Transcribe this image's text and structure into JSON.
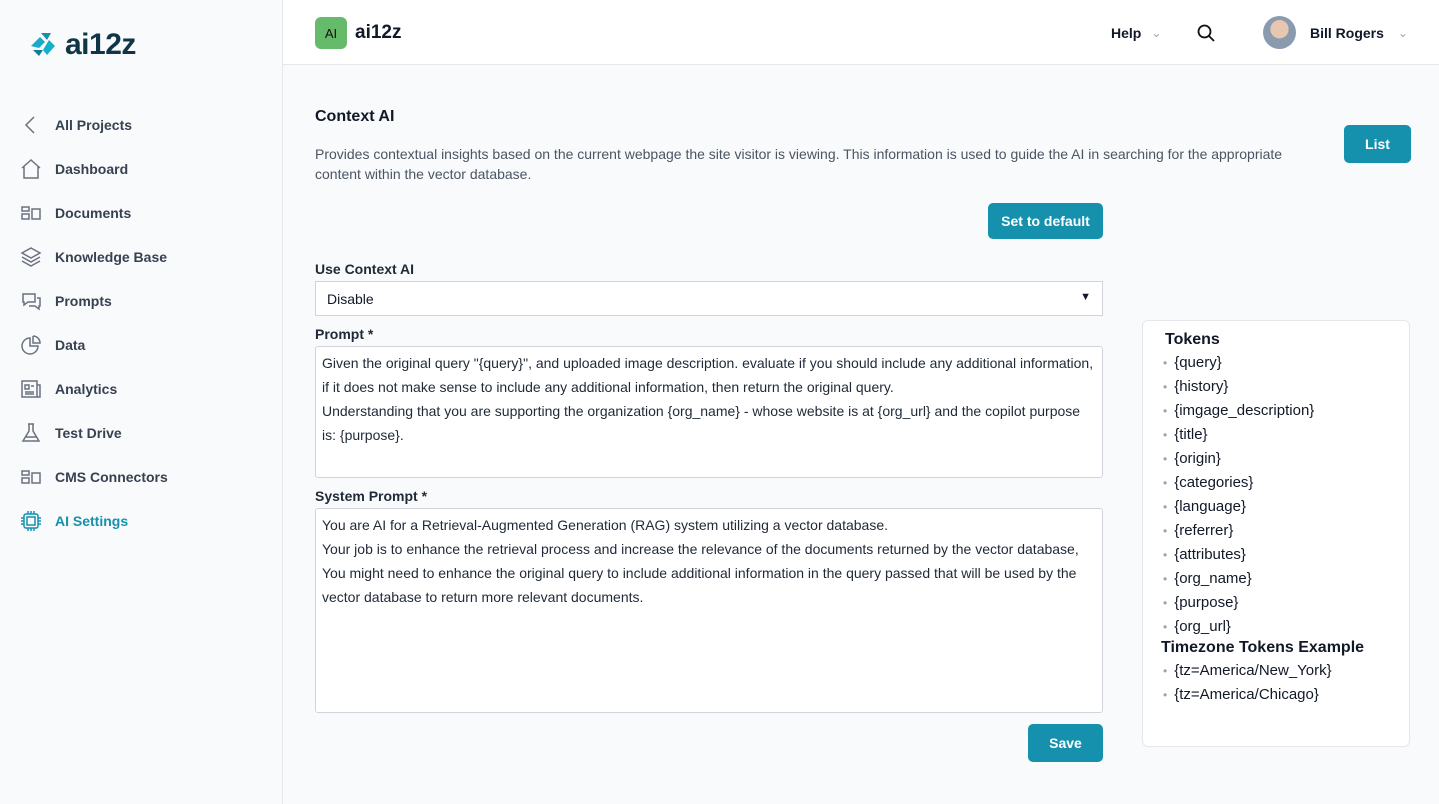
{
  "brand": {
    "logo_text": "ai12z"
  },
  "sidebar": {
    "items": [
      {
        "label": "All Projects",
        "icon": "chevron-left-icon"
      },
      {
        "label": "Dashboard",
        "icon": "home-icon"
      },
      {
        "label": "Documents",
        "icon": "documents-icon"
      },
      {
        "label": "Knowledge Base",
        "icon": "layers-icon"
      },
      {
        "label": "Prompts",
        "icon": "chat-icon"
      },
      {
        "label": "Data",
        "icon": "pie-chart-icon"
      },
      {
        "label": "Analytics",
        "icon": "newspaper-icon"
      },
      {
        "label": "Test Drive",
        "icon": "flask-icon"
      },
      {
        "label": "CMS Connectors",
        "icon": "connectors-icon"
      },
      {
        "label": "AI Settings",
        "icon": "chip-icon",
        "active": true
      }
    ]
  },
  "header": {
    "badge": "AI",
    "app_name": "ai12z",
    "help": "Help",
    "user_name": "Bill Rogers"
  },
  "page": {
    "title": "Context AI",
    "description": "Provides contextual insights based on the current webpage the site visitor is viewing. This information is used to guide the AI in searching for the appropriate content within the vector database.",
    "list_button": "List",
    "default_button": "Set to default",
    "save_button": "Save"
  },
  "form": {
    "use_label": "Use Context AI",
    "use_value": "Disable",
    "prompt_label": "Prompt *",
    "prompt_value": "Given the original query \"{query}\", and uploaded image description. evaluate if you should include any additional information, if it does not make sense to include any additional information, then return the original query.\nUnderstanding that you are supporting the organization {org_name} - whose website is at {org_url} and the copilot purpose is: {purpose}.",
    "system_label": "System Prompt *",
    "system_value": "You are AI for a Retrieval-Augmented Generation (RAG) system utilizing a vector database.\nYour job is to enhance the retrieval process and increase the relevance of the documents returned by the vector database,\nYou might need to enhance the original query to include additional information in the query passed that will be used by the vector database to return more relevant documents."
  },
  "tokens": {
    "title": "Tokens",
    "items": [
      "{query}",
      "{history}",
      "{imgage_description}",
      "{title}",
      "{origin}",
      "{categories}",
      "{language}",
      "{referrer}",
      "{attributes}",
      "{org_name}",
      "{purpose}",
      "{org_url}"
    ],
    "tz_title": "Timezone Tokens Example",
    "tz_items": [
      "{tz=America/New_York}",
      "{tz=America/Chicago}"
    ]
  },
  "colors": {
    "accent": "#1591ae",
    "badge": "#66bb6a"
  }
}
